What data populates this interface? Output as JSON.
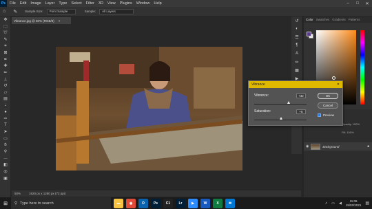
{
  "app": {
    "logo": "Ps"
  },
  "menu": [
    "File",
    "Edit",
    "Image",
    "Layer",
    "Type",
    "Select",
    "Filter",
    "3D",
    "View",
    "Plugins",
    "Window",
    "Help"
  ],
  "window_controls": {
    "minimize": "–",
    "maximize": "□",
    "close": "✕"
  },
  "options_bar": {
    "sample_size_label": "Sample Size:",
    "sample_size_value": "Point Sample",
    "sample_label": "Sample:",
    "sample_value": "All Layers"
  },
  "document": {
    "tab_title": "Vibrance.jpg @ 50% (RGB/8)",
    "tab_close": "×",
    "zoom": "50%",
    "doc_info": "1920 px x 1280 px (72 ppi)"
  },
  "tools": [
    "move-icon",
    "marquee-icon",
    "lasso-icon",
    "quick-select-icon",
    "crop-icon",
    "frame-icon",
    "eyedropper-icon",
    "healing-icon",
    "brush-icon",
    "stamp-icon",
    "history-brush-icon",
    "eraser-icon",
    "gradient-icon",
    "blur-icon",
    "dodge-icon",
    "pen-icon",
    "type-icon",
    "path-select-icon",
    "shape-icon",
    "hand-icon",
    "zoom-icon",
    "more-tools-icon",
    "foreground-background-icon",
    "quick-mask-icon",
    "screen-mode-icon"
  ],
  "panel_tabs": [
    "Color",
    "Swatches",
    "Gradients",
    "Patterns"
  ],
  "layers": {
    "kind_label": "Kind",
    "opacity_label": "Opacity: 100%",
    "fill_label": "Fill: 100%",
    "layer_name": "Background"
  },
  "dialog": {
    "title": "Vibrance",
    "vibrance_label": "Vibrance:",
    "vibrance_value": "+32",
    "vibrance_level": 0.66,
    "saturation_label": "Saturation:",
    "saturation_value": "+5",
    "saturation_level": 0.525,
    "ok_label": "OK",
    "cancel_label": "Cancel",
    "preview_label": "Preview",
    "preview_checked": true
  },
  "taskbar": {
    "search_placeholder": "Type here to search",
    "apps": [
      {
        "name": "file-explorer",
        "color": "#f6c342",
        "glyph": "▬"
      },
      {
        "name": "chrome",
        "color": "#e04b3a",
        "glyph": "◉"
      },
      {
        "name": "outlook",
        "color": "#0a64ad",
        "glyph": "O"
      },
      {
        "name": "photoshop",
        "color": "#001e36",
        "glyph": "Ps"
      },
      {
        "name": "capture-one",
        "color": "#222222",
        "glyph": "C1"
      },
      {
        "name": "lightroom",
        "color": "#001e36",
        "glyph": "Lr"
      },
      {
        "name": "zoom",
        "color": "#2d8cff",
        "glyph": "▶"
      },
      {
        "name": "word",
        "color": "#185abd",
        "glyph": "W"
      },
      {
        "name": "excel",
        "color": "#107c41",
        "glyph": "X"
      },
      {
        "name": "mail",
        "color": "#0078d4",
        "glyph": "✉"
      }
    ],
    "clock_time": "11:06",
    "clock_date": "19/02/2021"
  },
  "colors": {
    "dialog_title_bar": "#dfb900",
    "accent_blue": "#31a8ff"
  }
}
